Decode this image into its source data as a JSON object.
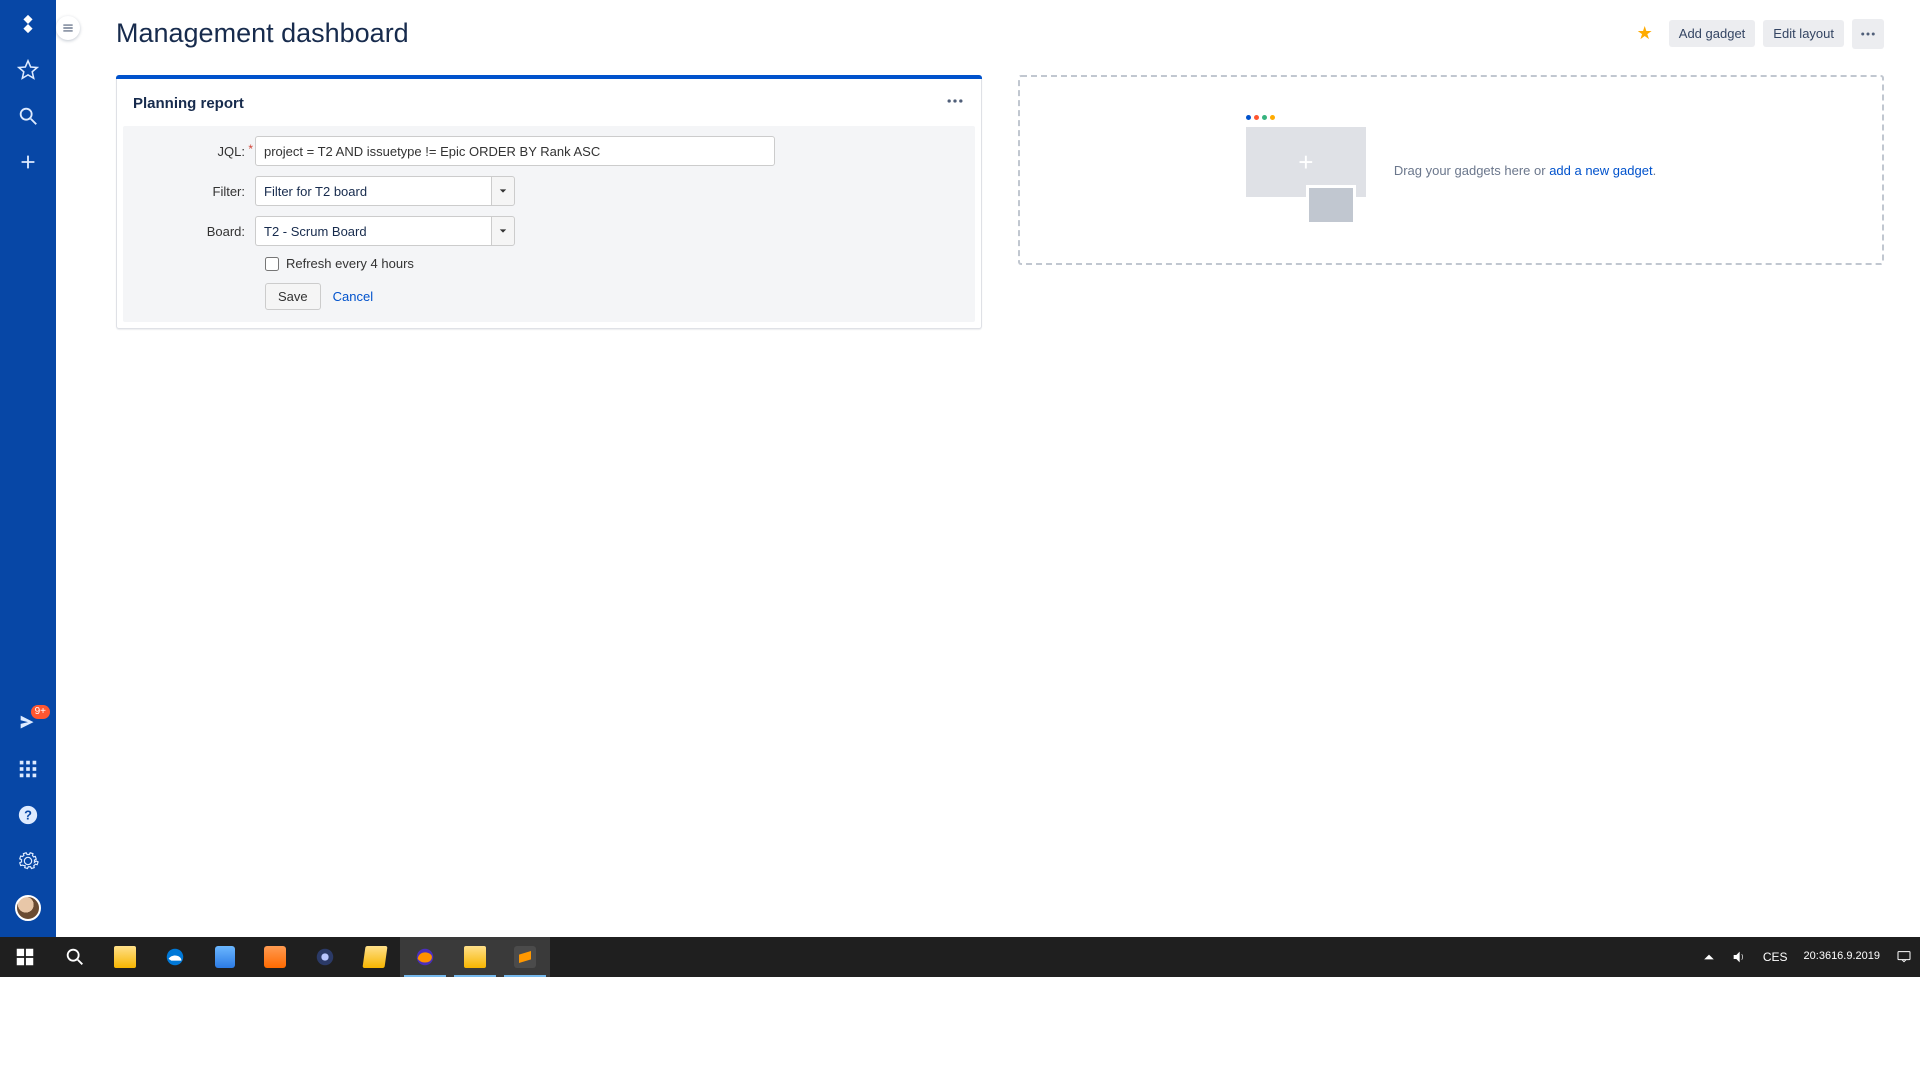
{
  "page": {
    "title": "Management dashboard"
  },
  "header": {
    "add_gadget": "Add gadget",
    "edit_layout": "Edit layout"
  },
  "gadget": {
    "title": "Planning report",
    "labels": {
      "jql": "JQL:",
      "filter": "Filter:",
      "board": "Board:"
    },
    "jql_value": "project = T2 AND issuetype != Epic ORDER BY Rank ASC",
    "filter_value": "Filter for T2 board",
    "board_value": "T2 - Scrum Board",
    "refresh_label": "Refresh every 4 hours",
    "save": "Save",
    "cancel": "Cancel"
  },
  "dropzone": {
    "text": "Drag your gadgets here or ",
    "link": "add a new gadget",
    "dot_colors": [
      "#0052CC",
      "#FF5630",
      "#36B37E",
      "#FFAB00"
    ]
  },
  "sidebar": {
    "notif_badge": "9+"
  },
  "taskbar": {
    "lang": "CES",
    "time": "20:36",
    "date": "16.9.2019"
  }
}
